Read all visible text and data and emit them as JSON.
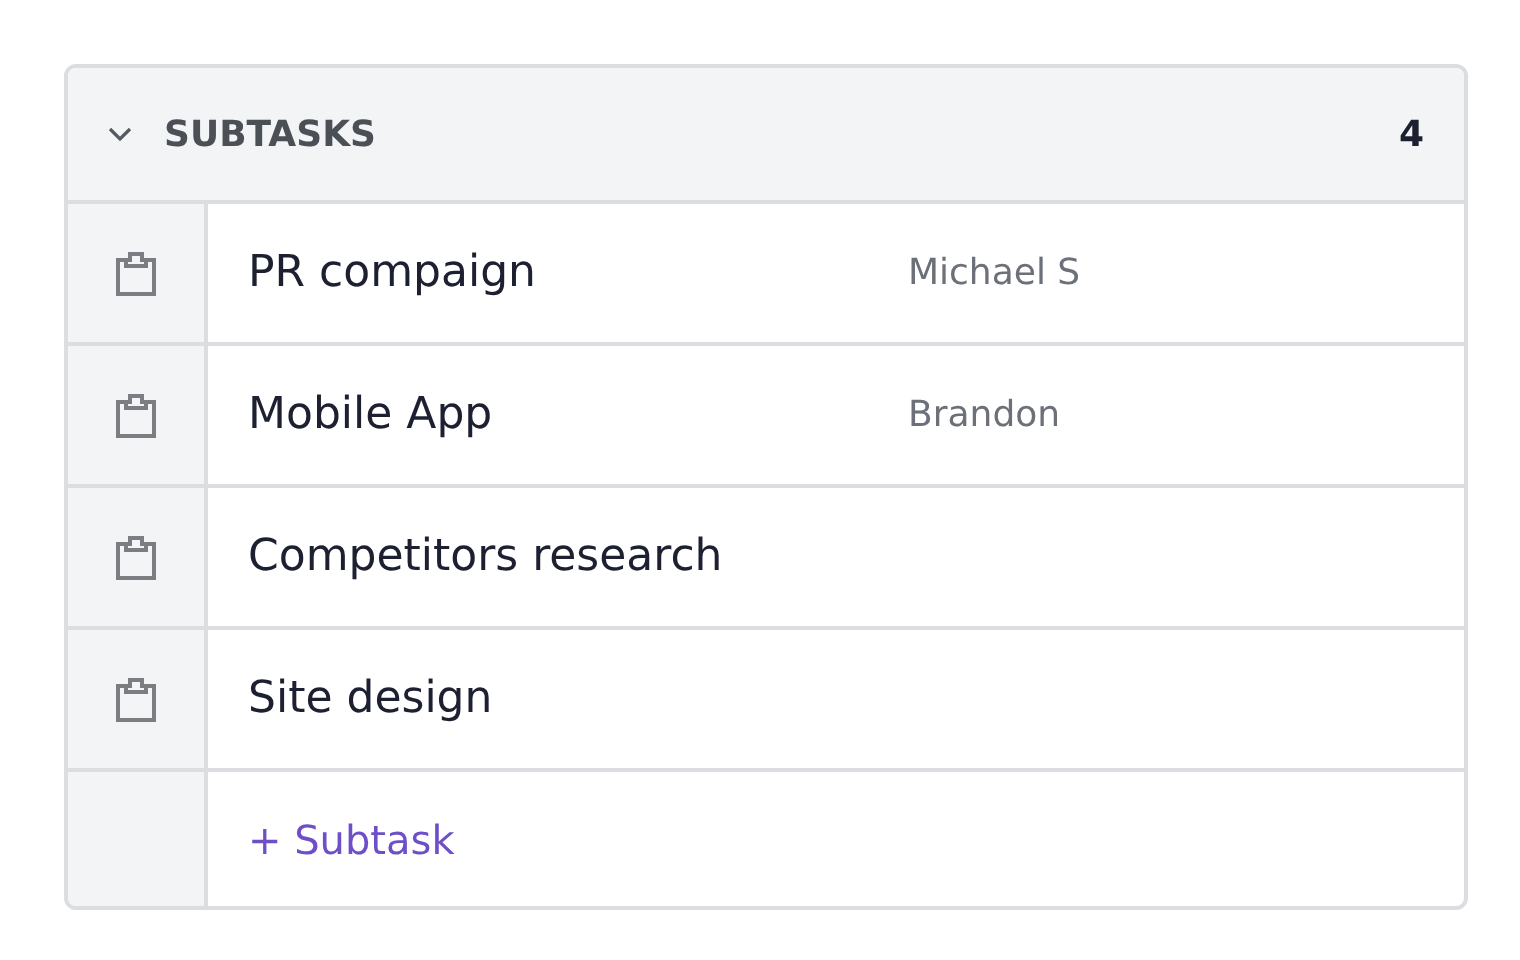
{
  "panel": {
    "title": "SUBTASKS",
    "count": "4",
    "expanded": true
  },
  "subtasks": [
    {
      "name": "PR compaign",
      "assignee": "Michael S"
    },
    {
      "name": "Mobile App",
      "assignee": "Brandon"
    },
    {
      "name": "Competitors research"
    },
    {
      "name": "Site design"
    }
  ],
  "add_link": "+ Subtask"
}
